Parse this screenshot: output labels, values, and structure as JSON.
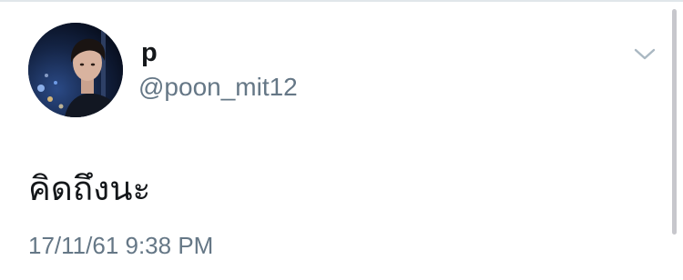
{
  "tweet": {
    "display_name": "p",
    "handle": "@poon_mit12",
    "text": "คิดถึงนะ",
    "timestamp": "17/11/61 9:38 PM"
  },
  "icons": {
    "menu": "chevron-down-icon",
    "avatar": "profile-photo"
  },
  "colors": {
    "primary_text": "#14171a",
    "secondary_text": "#657786",
    "chevron": "#aab8c2"
  }
}
